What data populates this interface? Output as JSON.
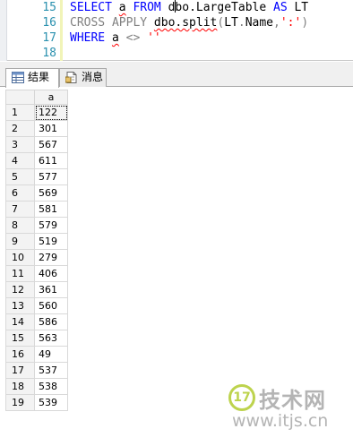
{
  "editor": {
    "lines": [
      {
        "number": "15",
        "tokens": [
          {
            "text": "SELECT",
            "cls": "kw"
          },
          {
            "text": " ",
            "cls": "plain"
          },
          {
            "text": "a",
            "cls": "plain squig"
          },
          {
            "text": " ",
            "cls": "plain"
          },
          {
            "text": "FROM",
            "cls": "kw"
          },
          {
            "text": " d",
            "cls": "plain"
          },
          {
            "text": "CURSOR",
            "cls": "cursor"
          },
          {
            "text": "bo.LargeTable",
            "cls": "plain"
          },
          {
            "text": " ",
            "cls": "plain"
          },
          {
            "text": "AS",
            "cls": "kw"
          },
          {
            "text": " LT",
            "cls": "plain"
          }
        ]
      },
      {
        "number": "16",
        "tokens": [
          {
            "text": "CROSS APPLY",
            "cls": "gray"
          },
          {
            "text": " ",
            "cls": "plain"
          },
          {
            "text": "dbo.split",
            "cls": "plain squig"
          },
          {
            "text": "(",
            "cls": "gray"
          },
          {
            "text": "LT",
            "cls": "plain"
          },
          {
            "text": ".",
            "cls": "gray"
          },
          {
            "text": "Name",
            "cls": "plain"
          },
          {
            "text": ",",
            "cls": "gray"
          },
          {
            "text": "':'",
            "cls": "red"
          },
          {
            "text": ")",
            "cls": "gray"
          }
        ]
      },
      {
        "number": "17",
        "tokens": [
          {
            "text": "WHERE",
            "cls": "kw"
          },
          {
            "text": " ",
            "cls": "plain"
          },
          {
            "text": "a",
            "cls": "plain squig"
          },
          {
            "text": " ",
            "cls": "plain"
          },
          {
            "text": "<>",
            "cls": "gray"
          },
          {
            "text": " ",
            "cls": "plain"
          },
          {
            "text": "''",
            "cls": "red"
          }
        ]
      },
      {
        "number": "18",
        "tokens": []
      }
    ]
  },
  "tabs": {
    "results_label": "结果",
    "messages_label": "消息"
  },
  "grid": {
    "column_header": "a",
    "rows": [
      {
        "n": "1",
        "a": "122"
      },
      {
        "n": "2",
        "a": "301"
      },
      {
        "n": "3",
        "a": "567"
      },
      {
        "n": "4",
        "a": "611"
      },
      {
        "n": "5",
        "a": "577"
      },
      {
        "n": "6",
        "a": "569"
      },
      {
        "n": "7",
        "a": "581"
      },
      {
        "n": "8",
        "a": "579"
      },
      {
        "n": "9",
        "a": "519"
      },
      {
        "n": "10",
        "a": "279"
      },
      {
        "n": "11",
        "a": "406"
      },
      {
        "n": "12",
        "a": "361"
      },
      {
        "n": "13",
        "a": "560"
      },
      {
        "n": "14",
        "a": "586"
      },
      {
        "n": "15",
        "a": "563"
      },
      {
        "n": "16",
        "a": "49"
      },
      {
        "n": "17",
        "a": "537"
      },
      {
        "n": "18",
        "a": "538"
      },
      {
        "n": "19",
        "a": "539"
      }
    ]
  },
  "watermark": {
    "logo_text": "17",
    "brand": "技术网",
    "url": "www.itjs.cn"
  }
}
